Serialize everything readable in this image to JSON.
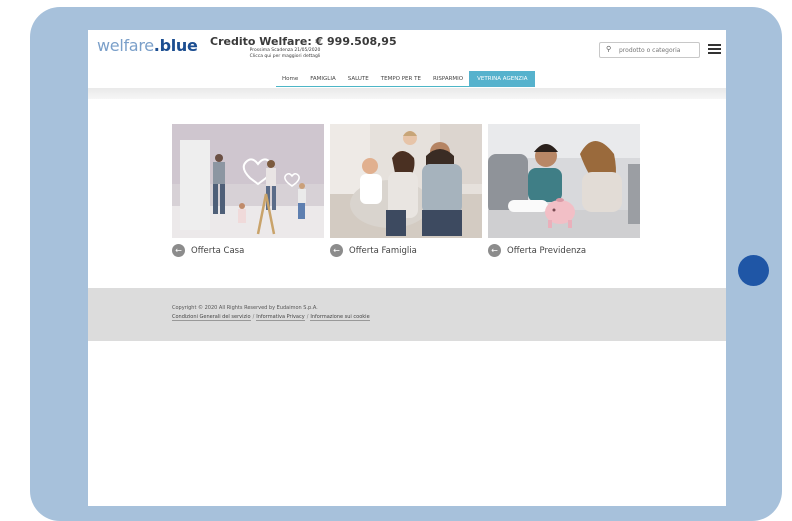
{
  "brand": {
    "logo_part1": "welfare",
    "logo_part2": ".blue"
  },
  "credit": {
    "title": "Credito Welfare: € 999.508,95",
    "expiry": "Prossima Scadenza 21/05/2020",
    "details_link": "Clicca qui per maggiori dettagli"
  },
  "search": {
    "icon": "search-icon",
    "placeholder": "prodotto o categoria"
  },
  "nav": {
    "tabs": [
      "Home",
      "FAMIGLIA",
      "SALUTE",
      "TEMPO PER TE",
      "RISPARMIO",
      "VETRINA AGENZIA"
    ],
    "active": "VETRINA AGENZIA"
  },
  "offers": [
    {
      "label": "Offerta Casa",
      "icon": "arrow-left-circle-icon"
    },
    {
      "label": "Offerta Famiglia",
      "icon": "arrow-left-circle-icon"
    },
    {
      "label": "Offerta Previdenza",
      "icon": "arrow-left-circle-icon"
    }
  ],
  "footer": {
    "copyright": "Copyright © 2020 All Rights Reserved by Eudaimon S.p.A.",
    "links": [
      "Condizioni Generali del servizio",
      "Informativa Privacy",
      "Informazione sui cookie"
    ],
    "separator": "/"
  },
  "colors": {
    "frame": "#a7c1db",
    "home_button": "#1f56a6",
    "accent": "#56b2cd",
    "brand_dark": "#1c4e91",
    "brand_light": "#7a9fc9",
    "footer_bg": "#dcdcdc"
  }
}
